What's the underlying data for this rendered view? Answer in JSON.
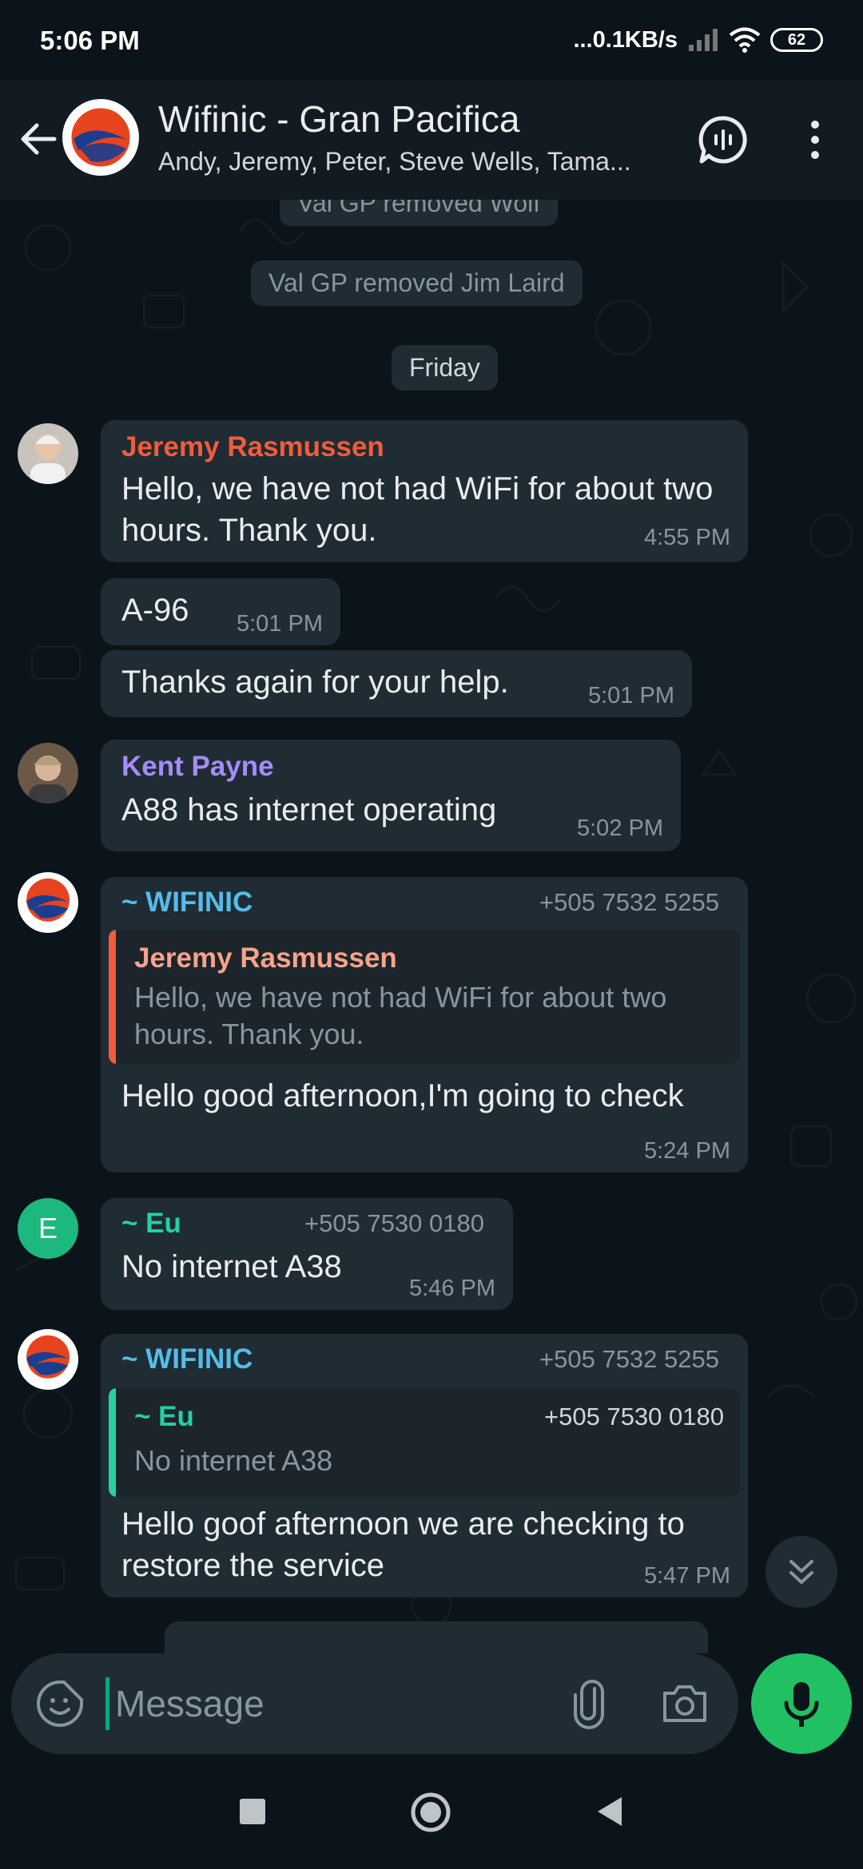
{
  "status_bar": {
    "time": "5:06 PM",
    "network_speed": "...0.1KB/s",
    "battery": "62",
    "icons": [
      "signal-icon",
      "wifi-icon",
      "battery-icon"
    ]
  },
  "header": {
    "title": "Wifinic - Gran Pacifica",
    "members": "Andy, Jeremy, Peter, Steve Wells, Tama..."
  },
  "chat": {
    "system_messages": [
      "Val GP removed Wolf",
      "Val GP removed Jim Laird"
    ],
    "date_divider": "Friday",
    "messages": [
      {
        "sender": "Jeremy Rasmussen",
        "text": "Hello, we have not had WiFi for about two hours. Thank you.",
        "time": "4:55 PM"
      },
      {
        "text": "A-96",
        "time": "5:01 PM"
      },
      {
        "text": "Thanks again for your help.",
        "time": "5:01 PM"
      },
      {
        "sender": "Kent Payne",
        "text": "A88 has internet operating",
        "time": "5:02 PM"
      },
      {
        "sender": "~ WIFINIC",
        "phone": "+505 7532 5255",
        "quote": {
          "sender": "Jeremy Rasmussen",
          "text": "Hello, we have not had WiFi for about two hours. Thank you."
        },
        "text": "Hello good afternoon,I'm going to check",
        "time": "5:24 PM"
      },
      {
        "avatar_letter": "E",
        "sender": "~ Eu",
        "phone": "+505 7530 0180",
        "text": "No internet A38",
        "time": "5:46 PM"
      },
      {
        "sender": "~ WIFINIC",
        "phone": "+505 7532 5255",
        "quote": {
          "sender": "~ Eu",
          "phone": "+505 7530 0180",
          "text": "No internet A38"
        },
        "text": "Hello goof afternoon we are checking to restore the service",
        "time": "5:47 PM"
      }
    ]
  },
  "composer": {
    "placeholder": "Message"
  },
  "colors": {
    "background": "#0b141a",
    "bubble": "#202c33",
    "accent_green": "#21c063",
    "jeremy": "#f15c3b",
    "kent": "#a78bfa",
    "wifinic": "#53bdeb",
    "eu": "#25d0a6",
    "eu_avatar": "#1db87e"
  }
}
